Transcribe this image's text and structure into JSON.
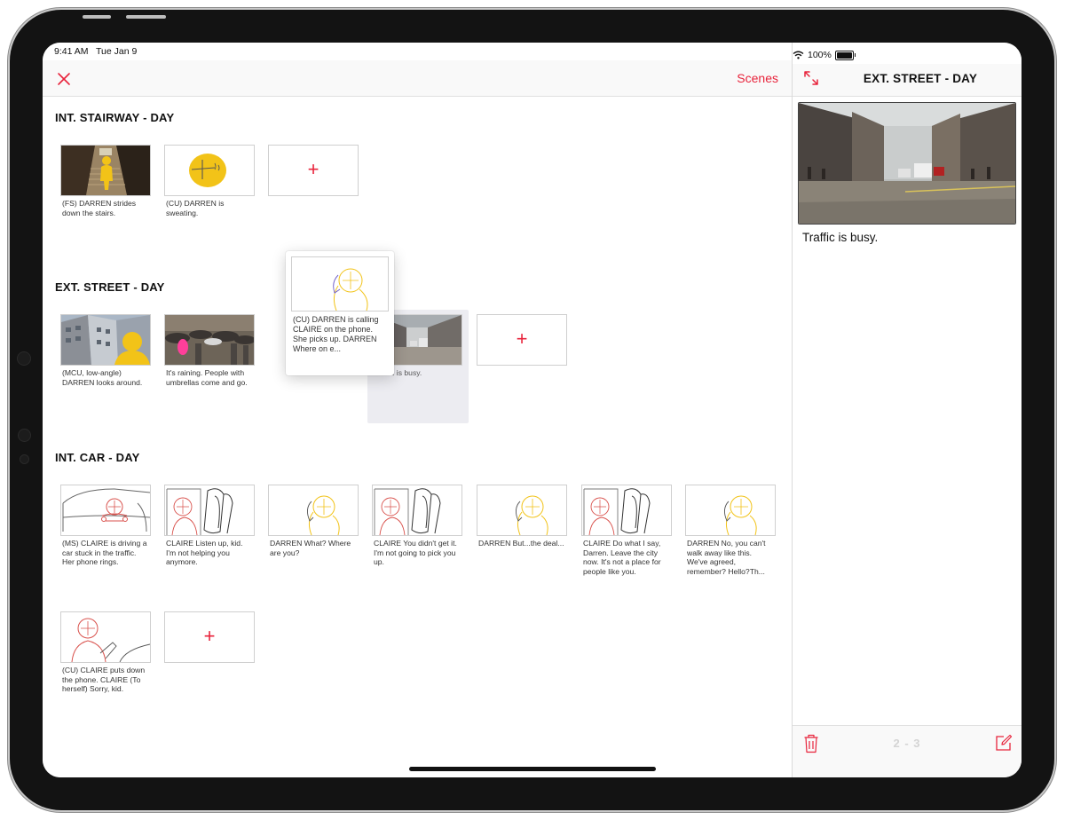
{
  "status_bar": {
    "time": "9:41 AM",
    "date": "Tue Jan 9",
    "battery": "100%"
  },
  "nav": {
    "scenes_label": "Scenes"
  },
  "colors": {
    "accent": "#e8243c",
    "sketch_yellow": "#f2c318",
    "sketch_red": "#d9524d"
  },
  "scenes": [
    {
      "title": "INT. STAIRWAY - DAY",
      "shots": [
        {
          "caption": "(FS) DARREN strides down the stairs.",
          "image": "photo-stairway"
        },
        {
          "caption": "(CU) DARREN is sweating.",
          "image": "sketch-yellow-head"
        }
      ]
    },
    {
      "title": "EXT. STREET - DAY",
      "shots": [
        {
          "caption": "(MCU, low-angle) DARREN looks around.",
          "image": "photo-building"
        },
        {
          "caption": "It's raining. People with umbrellas come and go.",
          "image": "photo-umbrellas"
        },
        {
          "caption": "Traffic is busy.",
          "image": "photo-street"
        }
      ]
    },
    {
      "title": "INT. CAR - DAY",
      "shots": [
        {
          "caption": "(MS) CLAIRE is driving a car stuck in the traffic. Her phone rings.",
          "image": "sketch-car"
        },
        {
          "caption": "CLAIRE Listen up, kid. I'm not helping you anymore.",
          "image": "sketch-claire-seat"
        },
        {
          "caption": "DARREN What? Where are you?",
          "image": "sketch-darren-phone"
        },
        {
          "caption": "CLAIRE You didn't get it. I'm not going to pick you up.",
          "image": "sketch-claire-seat"
        },
        {
          "caption": "DARREN But...the deal...",
          "image": "sketch-darren-phone"
        },
        {
          "caption": "CLAIRE Do what I say, Darren. Leave the city now. It's not a place for people like you.",
          "image": "sketch-claire-seat"
        },
        {
          "caption": "DARREN No, you can't walk away like this. We've agreed, remember? Hello?Th...",
          "image": "sketch-darren-phone"
        },
        {
          "caption": "(CU) CLAIRE puts down the phone. CLAIRE (To herself) Sorry, kid.",
          "image": "sketch-claire-phone"
        }
      ]
    }
  ],
  "dragging_card": {
    "caption": "(CU) DARREN is calling CLAIRE on the phone. She picks up. DARREN Where on e...",
    "image": "sketch-darren-phone"
  },
  "detail": {
    "title": "EXT. STREET - DAY",
    "caption": "Traffic is busy.",
    "pager": "2 - 3"
  }
}
